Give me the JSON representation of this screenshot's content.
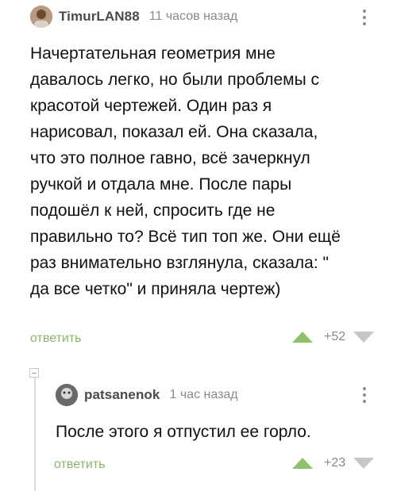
{
  "comments": [
    {
      "username": "TimurLAN88",
      "timestamp": "11 часов назад",
      "text": "Начертательная геометрия мне\nдавалось легко, но были проблемы с\nкрасотой чертежей. Один раз я\nнарисовал, показал ей. Она сказала,\nчто это полное гавно, всё зачеркнул\nручкой и отдала мне. После пары\nподошёл к ней, спросить где не\nправильно то? Всё тип топ же. Они ещё\nраз внимательно взглянула, сказала: \"\nда все четко\" и приняла чертеж)",
      "reply_label": "ответить",
      "score": "+52",
      "upvote_icon": "upvote-arrow-icon",
      "downvote_icon": "downvote-arrow-icon",
      "colors": {
        "upvote": "#8dc26a",
        "downvote": "#c7c7c7"
      }
    },
    {
      "username": "patsanenok",
      "timestamp": "1 час назад",
      "text": "После этого я отпустил ее горло.",
      "reply_label": "ответить",
      "score": "+23",
      "upvote_icon": "upvote-arrow-icon",
      "downvote_icon": "downvote-arrow-icon",
      "colors": {
        "upvote": "#8dc26a",
        "downvote": "#c7c7c7"
      }
    }
  ],
  "thread": {
    "collapse_icon": "collapse-minus-icon"
  },
  "colors": {
    "reply_link": "#86b766",
    "meta_text": "#8a8a8a"
  }
}
